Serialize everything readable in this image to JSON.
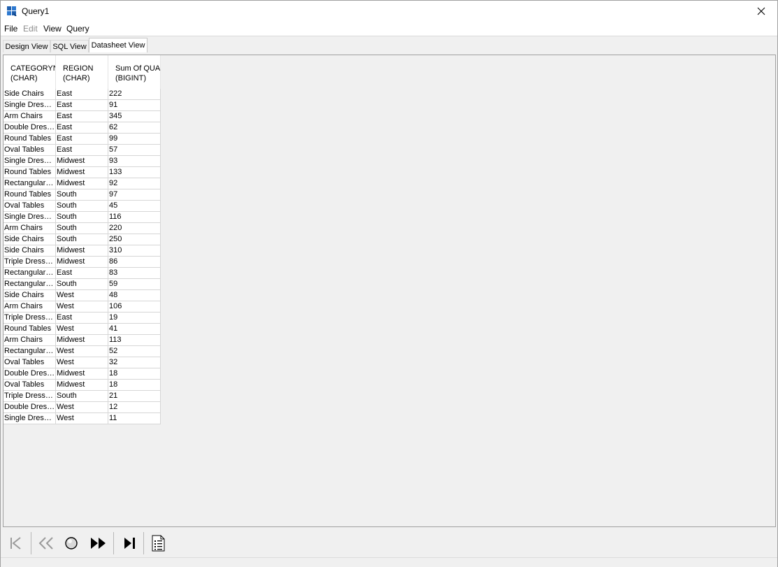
{
  "window": {
    "title": "Query1"
  },
  "menu": [
    "File",
    "Edit",
    "View",
    "Query"
  ],
  "tabs": [
    "Design View",
    "SQL View",
    "Datasheet View"
  ],
  "columns": [
    {
      "name": "CATEGORYNAME",
      "type": "(CHAR)"
    },
    {
      "name": "REGION",
      "type": "(CHAR)"
    },
    {
      "name": "Sum Of QUANTITY",
      "type": "(BIGINT)"
    }
  ],
  "rows": [
    [
      "Side Chairs",
      "East",
      "222"
    ],
    [
      "Single Dressers",
      "East",
      "91"
    ],
    [
      "Arm Chairs",
      "East",
      "345"
    ],
    [
      "Double Dressers",
      "East",
      "62"
    ],
    [
      "Round Tables",
      "East",
      "99"
    ],
    [
      "Oval Tables",
      "East",
      "57"
    ],
    [
      "Single Dressers",
      "Midwest",
      "93"
    ],
    [
      "Round Tables",
      "Midwest",
      "133"
    ],
    [
      "Rectangular Tables",
      "Midwest",
      "92"
    ],
    [
      "Round Tables",
      "South",
      "97"
    ],
    [
      "Oval Tables",
      "South",
      "45"
    ],
    [
      "Single Dressers",
      "South",
      "116"
    ],
    [
      "Arm Chairs",
      "South",
      "220"
    ],
    [
      "Side Chairs",
      "South",
      "250"
    ],
    [
      "Side Chairs",
      "Midwest",
      "310"
    ],
    [
      "Triple Dressers",
      "Midwest",
      "86"
    ],
    [
      "Rectangular Tables",
      "East",
      "83"
    ],
    [
      "Rectangular Tables",
      "South",
      "59"
    ],
    [
      "Side Chairs",
      "West",
      "48"
    ],
    [
      "Arm Chairs",
      "West",
      "106"
    ],
    [
      "Triple Dressers",
      "East",
      "19"
    ],
    [
      "Round Tables",
      "West",
      "41"
    ],
    [
      "Arm Chairs",
      "Midwest",
      "113"
    ],
    [
      "Rectangular Tables",
      "West",
      "52"
    ],
    [
      "Oval Tables",
      "West",
      "32"
    ],
    [
      "Double Dressers",
      "Midwest",
      "18"
    ],
    [
      "Oval Tables",
      "Midwest",
      "18"
    ],
    [
      "Triple Dressers",
      "South",
      "21"
    ],
    [
      "Double Dressers",
      "West",
      "12"
    ],
    [
      "Single Dressers",
      "West",
      "11"
    ]
  ],
  "toolbar": {
    "buttons": [
      "first-record-icon",
      "previous-record-icon",
      "stop-icon",
      "next-record-icon",
      "last-record-icon",
      "record-details-icon"
    ]
  },
  "colors": {
    "background": "#f0f0f0",
    "grid_line": "#d6d6d6",
    "app_icon": "#1f5fae"
  }
}
